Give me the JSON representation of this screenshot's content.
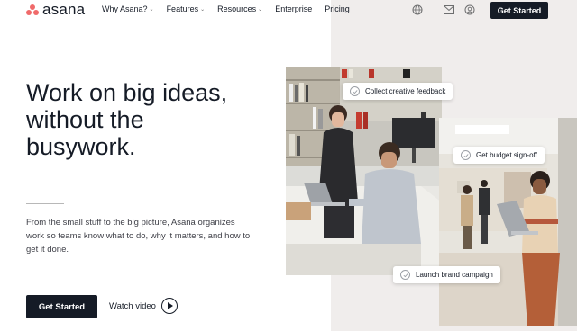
{
  "brand": {
    "name": "asana",
    "color": "#f06a6a"
  },
  "nav": {
    "links": [
      {
        "label": "Why Asana?",
        "dropdown": true
      },
      {
        "label": "Features",
        "dropdown": true
      },
      {
        "label": "Resources",
        "dropdown": true
      },
      {
        "label": "Enterprise",
        "dropdown": false
      },
      {
        "label": "Pricing",
        "dropdown": false
      }
    ],
    "icons": [
      "globe-icon",
      "mail-icon",
      "user-icon"
    ],
    "cta_label": "Get Started"
  },
  "hero": {
    "headline_lines": [
      "Work on big ideas,",
      "without the",
      "busywork."
    ],
    "subtext": "From the small stuff to the big picture, Asana organizes work so teams know what to do, why it matters, and how to get it done.",
    "cta_label": "Get Started",
    "video_label": "Watch video"
  },
  "tasks": [
    {
      "label": "Collect creative feedback"
    },
    {
      "label": "Get budget sign-off"
    },
    {
      "label": "Launch brand campaign"
    }
  ],
  "colors": {
    "dark": "#151b26",
    "panel": "#f0edec"
  }
}
